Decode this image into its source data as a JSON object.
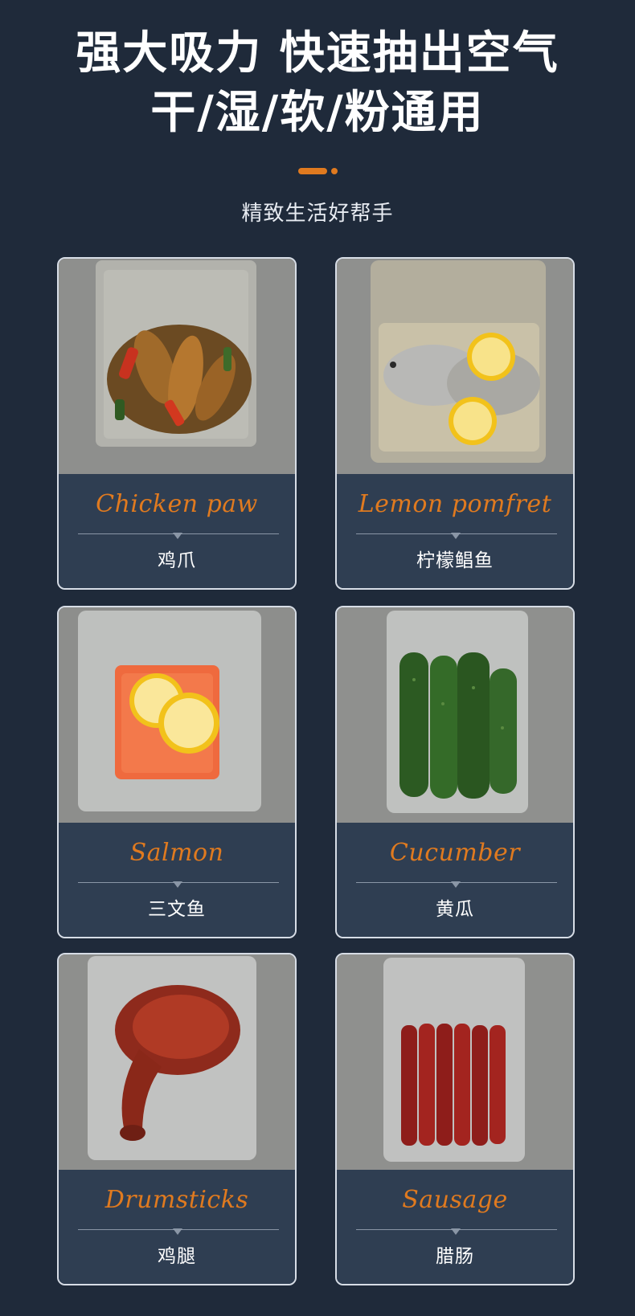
{
  "header": {
    "line1": "强大吸力 快速抽出空气",
    "line2": "干/湿/软/粉通用",
    "subtitle": "精致生活好帮手",
    "accent_color": "#e07a1f"
  },
  "cards": [
    {
      "en": "Chicken paw",
      "zh": "鸡爪",
      "photo_icon": "vacuum-bag-chicken-paw"
    },
    {
      "en": "Lemon pomfret",
      "zh": "柠檬鲳鱼",
      "photo_icon": "vacuum-bag-pomfret"
    },
    {
      "en": "Salmon",
      "zh": "三文鱼",
      "photo_icon": "vacuum-bag-salmon"
    },
    {
      "en": "Cucumber",
      "zh": "黄瓜",
      "photo_icon": "vacuum-bag-cucumber"
    },
    {
      "en": "Drumsticks",
      "zh": "鸡腿",
      "photo_icon": "vacuum-bag-drumstick"
    },
    {
      "en": "Sausage",
      "zh": "腊肠",
      "photo_icon": "vacuum-bag-sausage"
    }
  ],
  "colors": {
    "background": "#1f2a3a",
    "card_caption": "#2f3e52",
    "card_border": "#d7dde6",
    "english_label": "#e07a1f"
  }
}
